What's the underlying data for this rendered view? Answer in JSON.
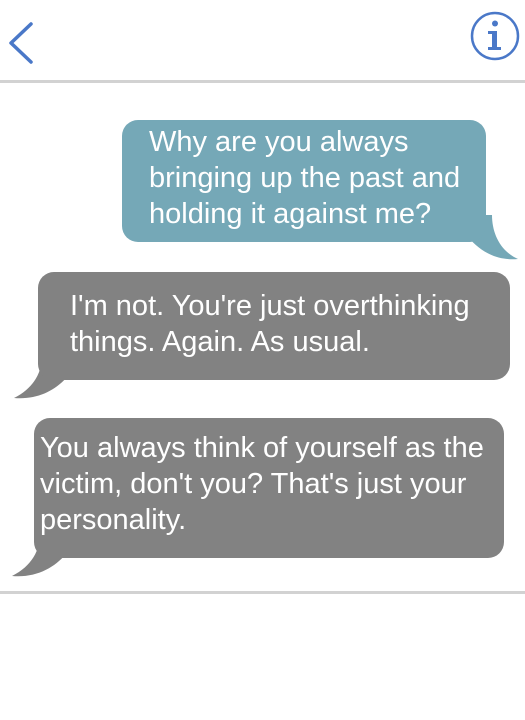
{
  "header": {
    "back_icon": "chevron-left-icon",
    "info_icon": "info-circle-icon",
    "accent_color": "#4a78c8"
  },
  "messages": [
    {
      "sender": "me",
      "text": "Why are you always\nbringing up the past and\nholding it against me?",
      "color": "#75a8b7"
    },
    {
      "sender": "them",
      "text": "I'm not. You're just overthinking\nthings. Again. As usual.",
      "color": "#828282"
    },
    {
      "sender": "them",
      "text": "You always think of yourself as the\nvictim, don't you? That's just your\npersonality.",
      "color": "#828282"
    }
  ]
}
